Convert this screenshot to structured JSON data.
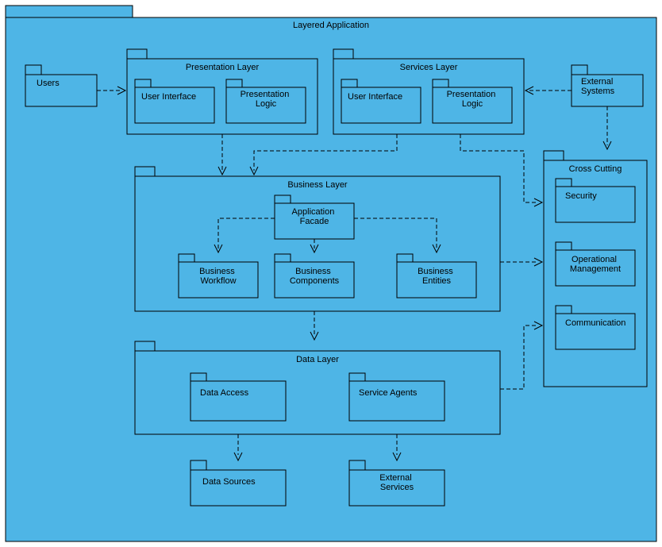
{
  "title": "Layered Application",
  "users": "Users",
  "external_systems": "External\nSystems",
  "presentation_layer": {
    "title": "Presentation Layer",
    "ui": "User Interface",
    "logic": "Presentation\nLogic"
  },
  "services_layer": {
    "title": "Services Layer",
    "ui": "User Interface",
    "logic": "Presentation\nLogic"
  },
  "business_layer": {
    "title": "Business Layer",
    "facade": "Application\nFacade",
    "workflow": "Business\nWorkflow",
    "components": "Business\nComponents",
    "entities": "Business\nEntities"
  },
  "data_layer": {
    "title": "Data Layer",
    "access": "Data Access",
    "agents": "Service Agents"
  },
  "cross_cutting": {
    "title": "Cross Cutting",
    "security": "Security",
    "op_mgmt": "Operational\nManagement",
    "comm": "Communication"
  },
  "data_sources": "Data Sources",
  "external_services": "External\nServices"
}
